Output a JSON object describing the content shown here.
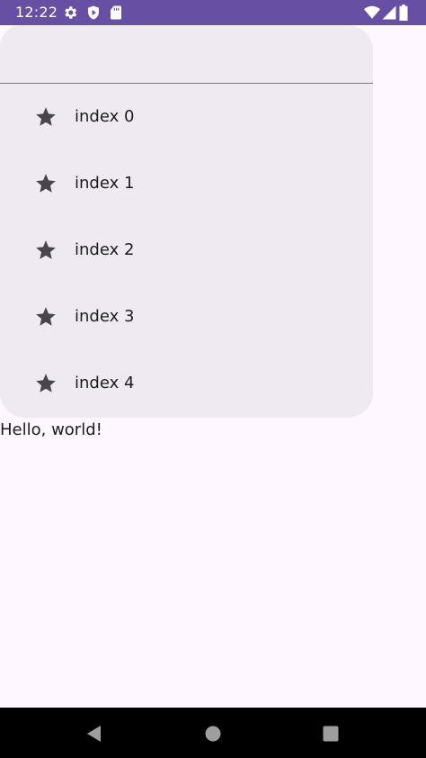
{
  "status_bar": {
    "time": "12:22",
    "icons": [
      "settings-icon",
      "shield-icon",
      "sd-card-icon",
      "wifi-icon",
      "signal-icon",
      "battery-icon"
    ],
    "background": "#6750A4"
  },
  "drawer": {
    "background": "#EFEAF2",
    "items": [
      {
        "icon": "star-icon",
        "label": "index 0"
      },
      {
        "icon": "star-icon",
        "label": "index 1"
      },
      {
        "icon": "star-icon",
        "label": "index 2"
      },
      {
        "icon": "star-icon",
        "label": "index 3"
      },
      {
        "icon": "star-icon",
        "label": "index 4"
      }
    ]
  },
  "content": {
    "text": "Hello, world!"
  },
  "nav_bar": {
    "buttons": [
      "back-icon",
      "home-icon",
      "recents-icon"
    ]
  }
}
